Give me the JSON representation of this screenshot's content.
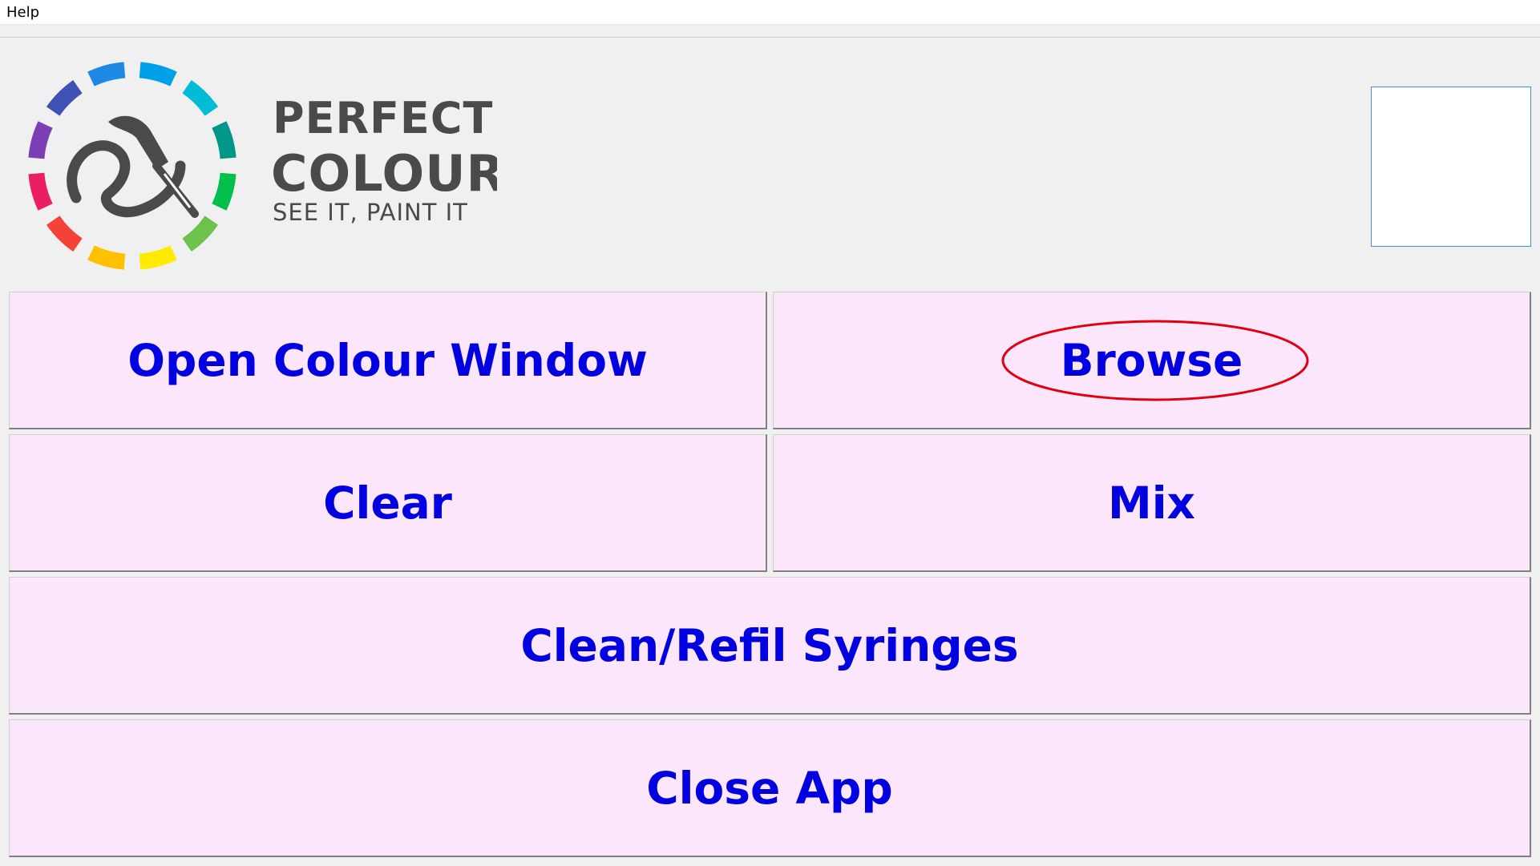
{
  "menu": {
    "help_label": "Help"
  },
  "logo": {
    "line1": "PERFECT",
    "line2": "COLOUR",
    "tagline": "SEE IT, PAINT IT",
    "wheel_colors": [
      "#00a0e9",
      "#00bcd4",
      "#009688",
      "#00c04b",
      "#6cc24a",
      "#ffeb00",
      "#ffc000",
      "#f44336",
      "#e91e63",
      "#7b3fb5",
      "#3f51b5",
      "#1e88e5"
    ]
  },
  "buttons": {
    "open_colour_window": "Open Colour Window",
    "browse": "Browse",
    "clear": "Clear",
    "mix": "Mix",
    "clean_refil": "Clean/Refil Syringes",
    "close_app": "Close App"
  },
  "colors": {
    "button_bg": "#fbe6fb",
    "button_text": "#0000e0",
    "highlight_ring": "#e00010"
  }
}
